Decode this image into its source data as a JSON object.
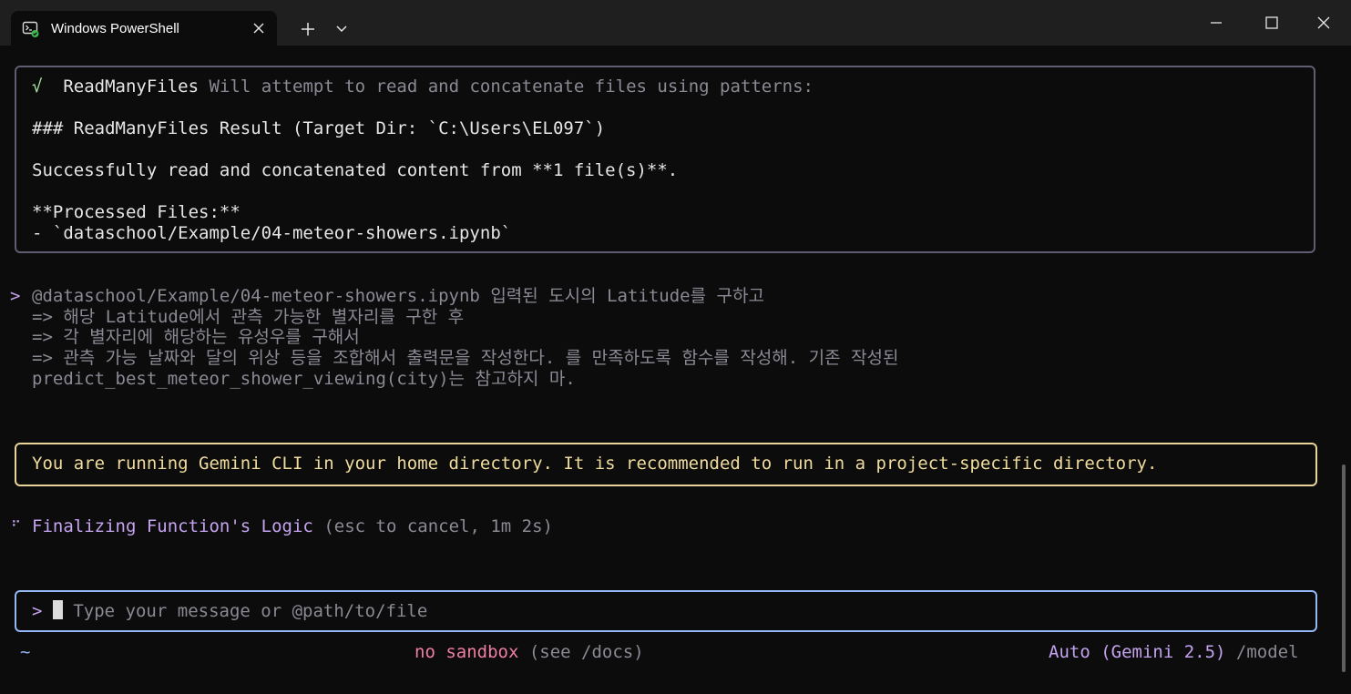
{
  "window": {
    "tab_title": "Windows PowerShell",
    "new_tab_symbol": "+",
    "icons": {
      "tab": "powershell-icon",
      "close_tab": "close-icon",
      "new_tab": "plus-icon",
      "dropdown": "chevron-down-icon",
      "minimize": "minimize-icon",
      "maximize": "maximize-icon",
      "close_window": "close-icon"
    }
  },
  "tool_result": {
    "check": "√",
    "tool_name": "ReadManyFiles",
    "description": "Will attempt to read and concatenate files using patterns:",
    "result_heading": "### ReadManyFiles Result (Target Dir: `C:\\Users\\EL097`)",
    "success_line": "Successfully read and concatenated content from **1 file(s)**.",
    "processed_label": "**Processed Files:**",
    "processed_file": "- `dataschool/Example/04-meteor-showers.ipynb`"
  },
  "user_prompt": {
    "marker": ">",
    "lines": [
      "@dataschool/Example/04-meteor-showers.ipynb 입력된 도시의 Latitude를 구하고",
      "=> 해당 Latitude에서 관측 가능한 별자리를 구한 후",
      "=> 각 별자리에 해당하는 유성우를 구해서",
      "=> 관측 가능 날짜와 달의 위상 등을 조합해서 출력문을 작성한다. 를 만족하도록 함수를 작성해. 기존 작성된",
      "predict_best_meteor_shower_viewing(city)는 참고하지 마."
    ]
  },
  "warning": {
    "text": "You are running Gemini CLI in your home directory. It is recommended to run in a project-specific directory."
  },
  "status": {
    "spinner": "⠋",
    "label": "Finalizing Function's Logic",
    "hint": "(esc to cancel, 1m 2s)"
  },
  "input": {
    "prompt": ">",
    "placeholder": "Type your message or @path/to/file"
  },
  "footer": {
    "cwd": "~",
    "sandbox": "no sandbox",
    "sandbox_hint": "(see /docs)",
    "model": "Auto (Gemini 2.5)",
    "model_hint": "/model"
  },
  "colors": {
    "terminal_bg": "#0c0c0c",
    "titlebar_bg": "#1f1f1f",
    "check_green": "#a6e3a1",
    "prompt_purple": "#c5a3f0",
    "warning_yellow": "#f0dc9c",
    "input_border": "#93b8f5",
    "sandbox_pink": "#f07fa3",
    "dim_gray": "#8a8a94"
  }
}
